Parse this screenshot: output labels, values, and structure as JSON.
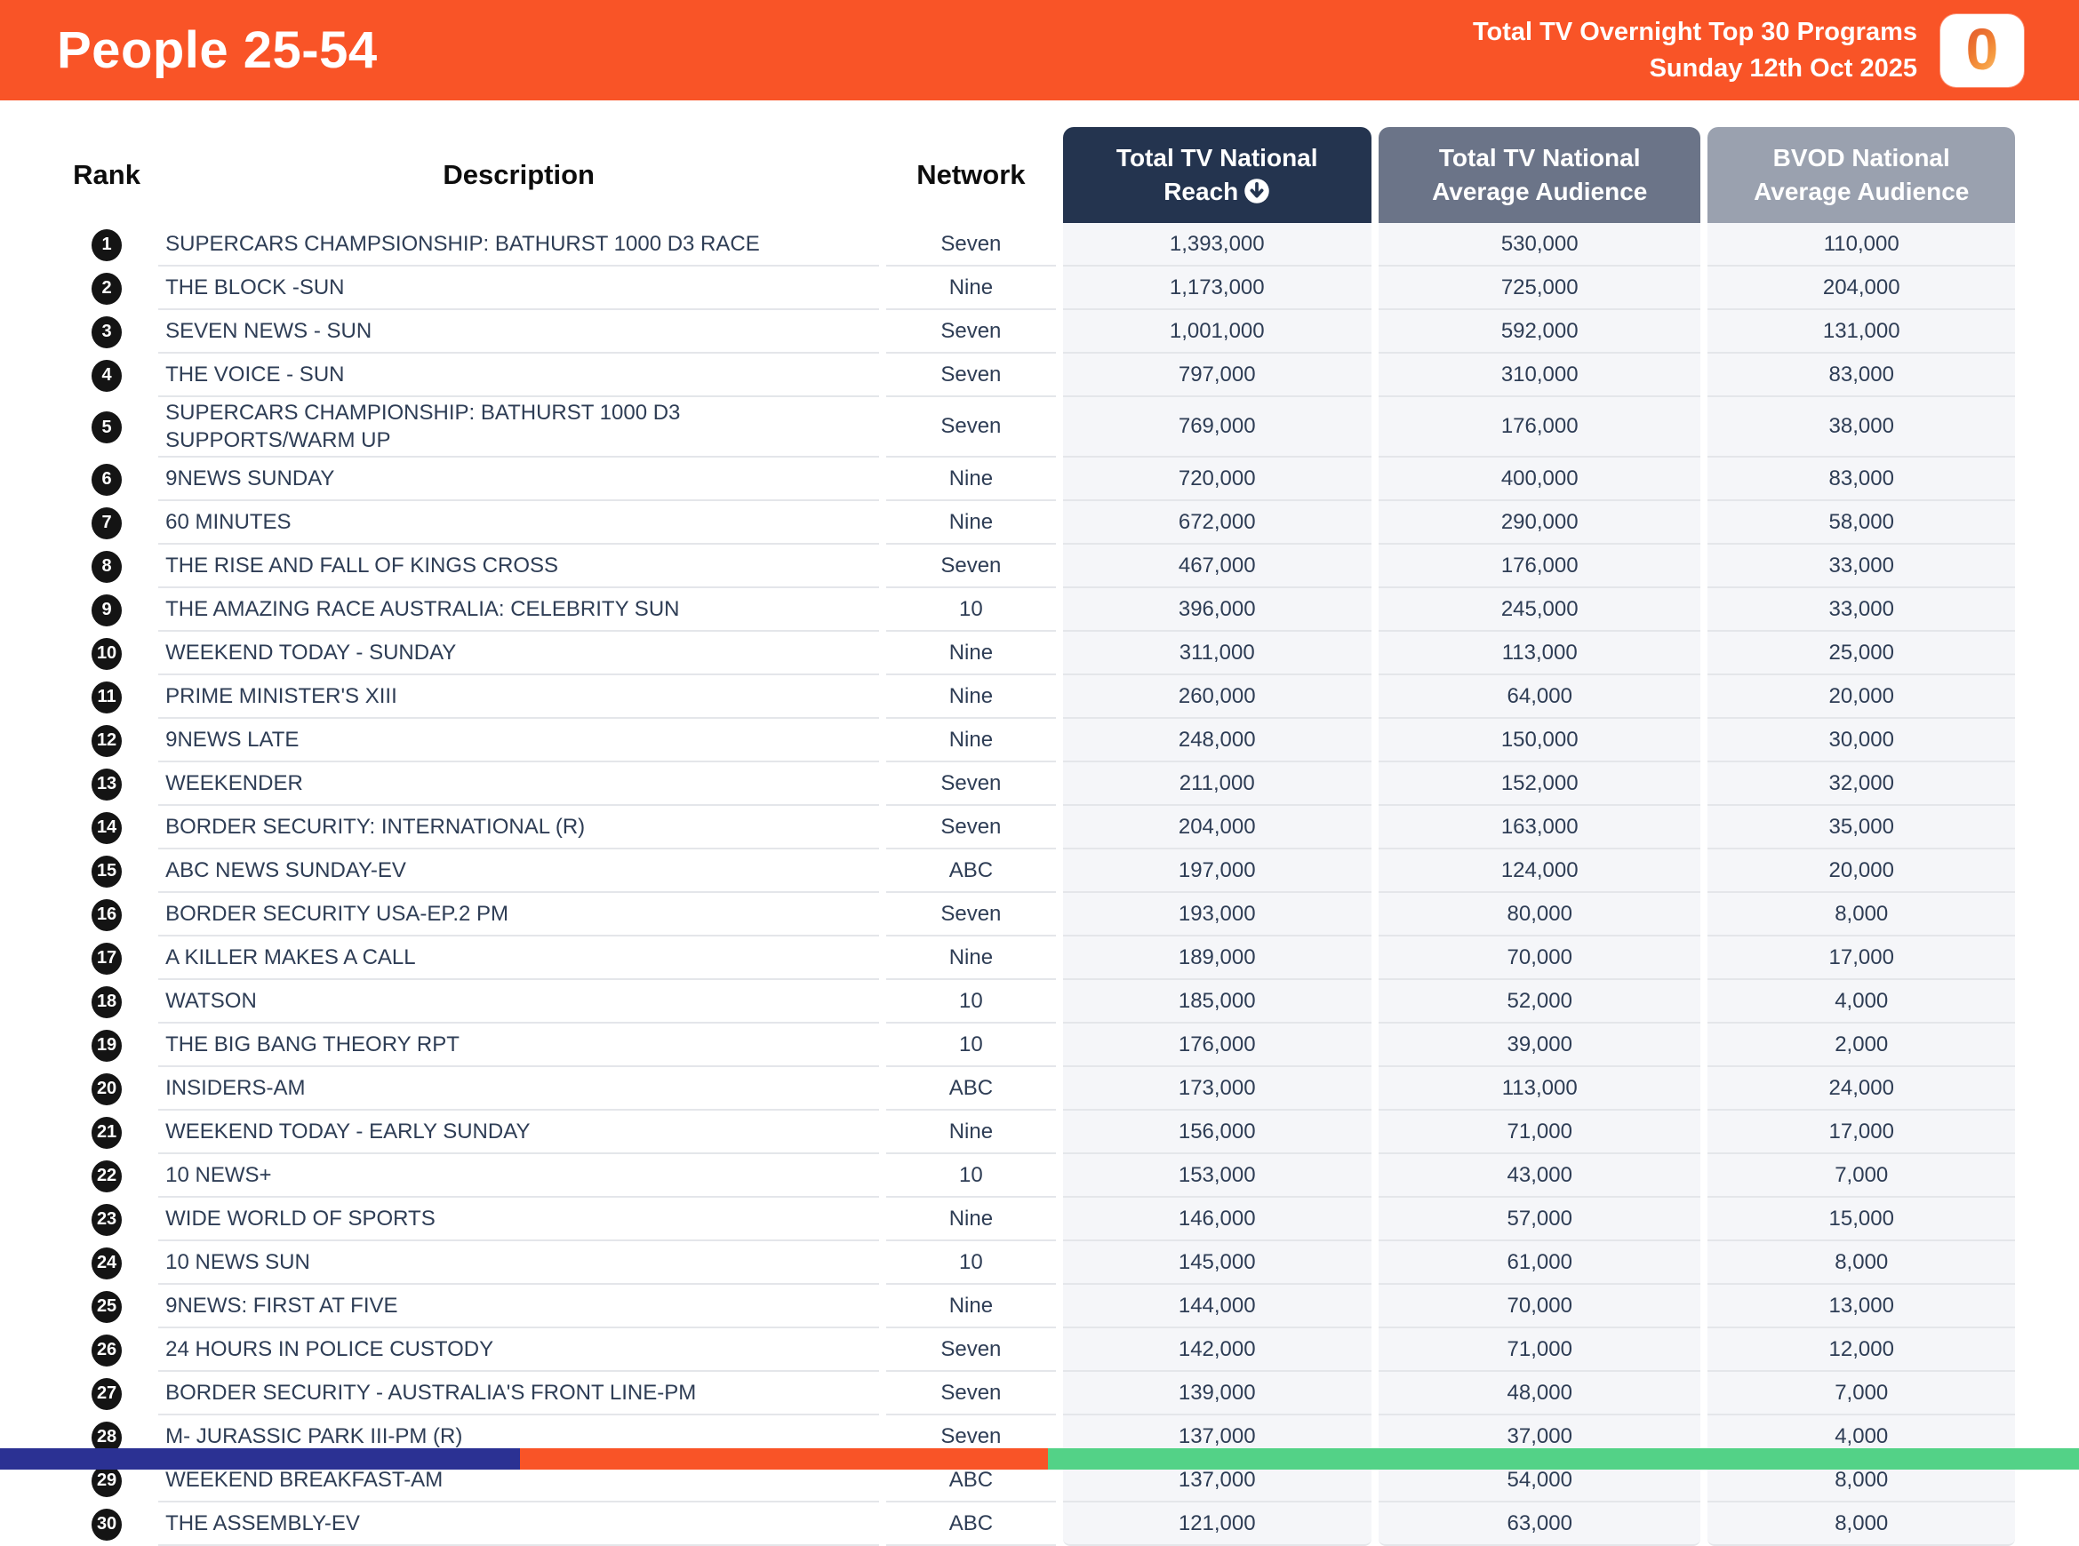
{
  "header": {
    "title": "People 25-54",
    "subtitle1": "Total TV Overnight Top 30 Programs",
    "subtitle2": "Sunday 12th Oct 2025",
    "logo_glyph": "0"
  },
  "colors": {
    "banner-orange": "#F95427",
    "header-navy": "#24344F",
    "header-slate": "#6B7488",
    "header-gray": "#9AA1AF",
    "bar-indigo": "#2B3193",
    "bar-orange": "#F95427",
    "bar-green": "#53D287",
    "row-text": "#2E3D55"
  },
  "table": {
    "columns": {
      "rank": "Rank",
      "description": "Description",
      "network": "Network",
      "reach": "Total TV National Reach",
      "avg": "Total TV National Average Audience",
      "bvod": "BVOD National Average Audience"
    },
    "sort_icon": "circle-down-arrow",
    "rows": [
      {
        "rank": "1",
        "description": "SUPERCARS CHAMPSIONSHIP: BATHURST 1000 D3 RACE",
        "network": "Seven",
        "reach": "1,393,000",
        "avg": "530,000",
        "bvod": "110,000"
      },
      {
        "rank": "2",
        "description": "THE BLOCK -SUN",
        "network": "Nine",
        "reach": "1,173,000",
        "avg": "725,000",
        "bvod": "204,000"
      },
      {
        "rank": "3",
        "description": "SEVEN NEWS - SUN",
        "network": "Seven",
        "reach": "1,001,000",
        "avg": "592,000",
        "bvod": "131,000"
      },
      {
        "rank": "4",
        "description": "THE VOICE - SUN",
        "network": "Seven",
        "reach": "797,000",
        "avg": "310,000",
        "bvod": "83,000"
      },
      {
        "rank": "5",
        "description": "SUPERCARS CHAMPIONSHIP: BATHURST 1000 D3 SUPPORTS/WARM UP",
        "network": "Seven",
        "reach": "769,000",
        "avg": "176,000",
        "bvod": "38,000"
      },
      {
        "rank": "6",
        "description": "9NEWS SUNDAY",
        "network": "Nine",
        "reach": "720,000",
        "avg": "400,000",
        "bvod": "83,000"
      },
      {
        "rank": "7",
        "description": "60 MINUTES",
        "network": "Nine",
        "reach": "672,000",
        "avg": "290,000",
        "bvod": "58,000"
      },
      {
        "rank": "8",
        "description": "THE RISE AND FALL OF KINGS CROSS",
        "network": "Seven",
        "reach": "467,000",
        "avg": "176,000",
        "bvod": "33,000"
      },
      {
        "rank": "9",
        "description": "THE AMAZING RACE AUSTRALIA: CELEBRITY SUN",
        "network": "10",
        "reach": "396,000",
        "avg": "245,000",
        "bvod": "33,000"
      },
      {
        "rank": "10",
        "description": "WEEKEND TODAY - SUNDAY",
        "network": "Nine",
        "reach": "311,000",
        "avg": "113,000",
        "bvod": "25,000"
      },
      {
        "rank": "11",
        "description": "PRIME MINISTER'S XIII",
        "network": "Nine",
        "reach": "260,000",
        "avg": "64,000",
        "bvod": "20,000"
      },
      {
        "rank": "12",
        "description": "9NEWS LATE",
        "network": "Nine",
        "reach": "248,000",
        "avg": "150,000",
        "bvod": "30,000"
      },
      {
        "rank": "13",
        "description": "WEEKENDER",
        "network": "Seven",
        "reach": "211,000",
        "avg": "152,000",
        "bvod": "32,000"
      },
      {
        "rank": "14",
        "description": "BORDER SECURITY: INTERNATIONAL (R)",
        "network": "Seven",
        "reach": "204,000",
        "avg": "163,000",
        "bvod": "35,000"
      },
      {
        "rank": "15",
        "description": "ABC NEWS SUNDAY-EV",
        "network": "ABC",
        "reach": "197,000",
        "avg": "124,000",
        "bvod": "20,000"
      },
      {
        "rank": "16",
        "description": "BORDER SECURITY USA-EP.2 PM",
        "network": "Seven",
        "reach": "193,000",
        "avg": "80,000",
        "bvod": "8,000"
      },
      {
        "rank": "17",
        "description": "A KILLER MAKES A CALL",
        "network": "Nine",
        "reach": "189,000",
        "avg": "70,000",
        "bvod": "17,000"
      },
      {
        "rank": "18",
        "description": "WATSON",
        "network": "10",
        "reach": "185,000",
        "avg": "52,000",
        "bvod": "4,000"
      },
      {
        "rank": "19",
        "description": "THE BIG BANG THEORY RPT",
        "network": "10",
        "reach": "176,000",
        "avg": "39,000",
        "bvod": "2,000"
      },
      {
        "rank": "20",
        "description": "INSIDERS-AM",
        "network": "ABC",
        "reach": "173,000",
        "avg": "113,000",
        "bvod": "24,000"
      },
      {
        "rank": "21",
        "description": "WEEKEND TODAY - EARLY SUNDAY",
        "network": "Nine",
        "reach": "156,000",
        "avg": "71,000",
        "bvod": "17,000"
      },
      {
        "rank": "22",
        "description": "10 NEWS+",
        "network": "10",
        "reach": "153,000",
        "avg": "43,000",
        "bvod": "7,000"
      },
      {
        "rank": "23",
        "description": "WIDE WORLD OF SPORTS",
        "network": "Nine",
        "reach": "146,000",
        "avg": "57,000",
        "bvod": "15,000"
      },
      {
        "rank": "24",
        "description": "10 NEWS SUN",
        "network": "10",
        "reach": "145,000",
        "avg": "61,000",
        "bvod": "8,000"
      },
      {
        "rank": "25",
        "description": "9NEWS: FIRST AT FIVE",
        "network": "Nine",
        "reach": "144,000",
        "avg": "70,000",
        "bvod": "13,000"
      },
      {
        "rank": "26",
        "description": "24 HOURS IN POLICE CUSTODY",
        "network": "Seven",
        "reach": "142,000",
        "avg": "71,000",
        "bvod": "12,000"
      },
      {
        "rank": "27",
        "description": "BORDER SECURITY - AUSTRALIA'S FRONT LINE-PM",
        "network": "Seven",
        "reach": "139,000",
        "avg": "48,000",
        "bvod": "7,000"
      },
      {
        "rank": "28",
        "description": "M- JURASSIC PARK III-PM (R)",
        "network": "Seven",
        "reach": "137,000",
        "avg": "37,000",
        "bvod": "4,000"
      },
      {
        "rank": "29",
        "description": "WEEKEND BREAKFAST-AM",
        "network": "ABC",
        "reach": "137,000",
        "avg": "54,000",
        "bvod": "8,000"
      },
      {
        "rank": "30",
        "description": "THE ASSEMBLY-EV",
        "network": "ABC",
        "reach": "121,000",
        "avg": "63,000",
        "bvod": "8,000"
      }
    ]
  },
  "footer_bar": {
    "segments": [
      {
        "name": "indigo-segment",
        "color": "#2B3193",
        "width_pct": 25.0
      },
      {
        "name": "orange-segment",
        "color": "#F95427",
        "width_pct": 25.4
      },
      {
        "name": "green-segment",
        "color": "#53D287",
        "width_pct": 49.6
      }
    ]
  }
}
